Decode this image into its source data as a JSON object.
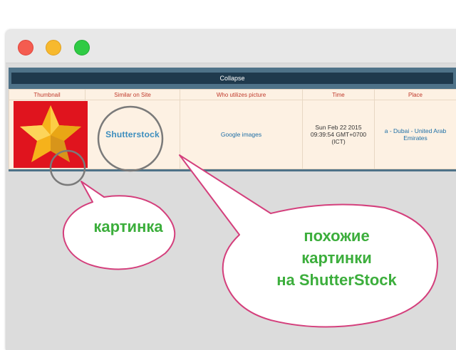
{
  "window": {
    "controls": [
      "close",
      "minimize",
      "maximize"
    ]
  },
  "collapse_label": "Collapse",
  "table": {
    "columns": [
      "Thumbnail",
      "Similar on Site",
      "Who utilizes picture",
      "Time",
      "Place"
    ],
    "row": {
      "thumbnail_icon": "star-icon",
      "similar_site": "Shutterstock",
      "who_utilizes": "Google images",
      "time": "Sun Feb 22 2015 09:39:54 GMT+0700 (ICT)",
      "place": "a - Dubai - United Arab Emirates"
    }
  },
  "callouts": {
    "picture": "картинка",
    "similar_line1": "похожие",
    "similar_line2": "картинки",
    "similar_line3": "на ShutterStock"
  },
  "colors": {
    "collapse_bar": "#1f3a4d",
    "header_text": "#c0392b",
    "callout_text": "#3cae3c",
    "callout_border": "#d43f7c",
    "thumbnail_bg": "#e0141e"
  }
}
